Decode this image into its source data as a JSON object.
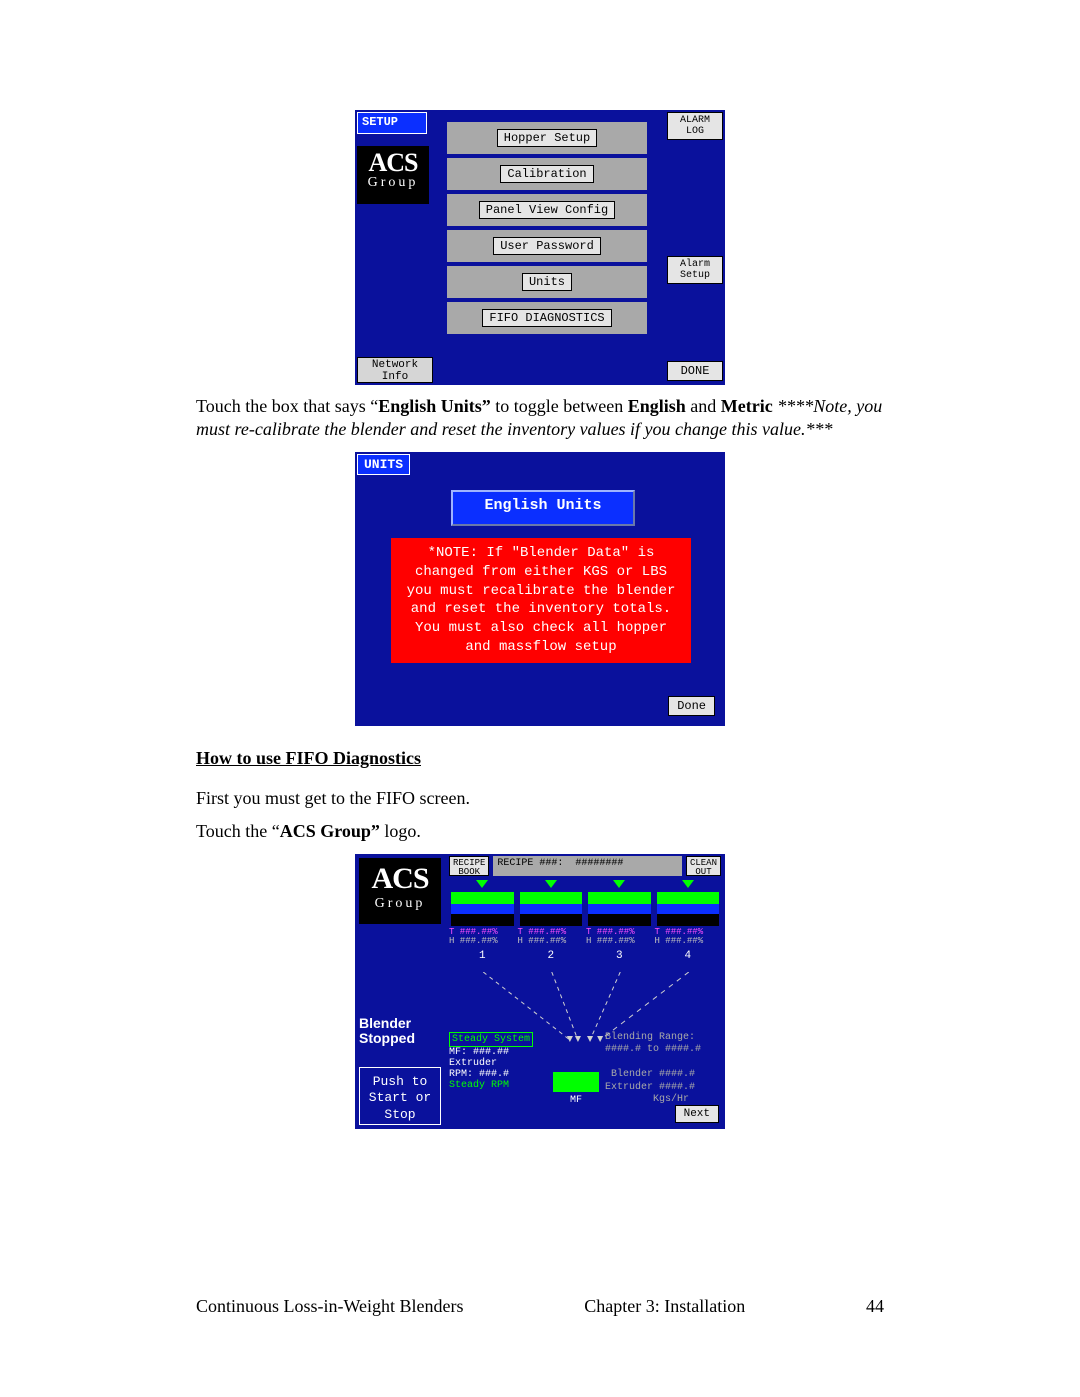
{
  "setup_screen": {
    "title": "SETUP",
    "logo_top": "ACS",
    "logo_bottom": "Group",
    "menu_items": [
      "Hopper Setup",
      "Calibration",
      "Panel View Config",
      "User Password",
      "Units",
      "FIFO DIAGNOSTICS"
    ],
    "network_btn": "Network\nInfo",
    "alarm_log_btn": "ALARM\nLOG",
    "alarm_setup_btn": "Alarm\nSetup",
    "done_btn": "DONE"
  },
  "paragraph1_prefix": "Touch the box that says “",
  "paragraph1_bold1": "English Units”",
  "paragraph1_mid": " to toggle between ",
  "paragraph1_bold2": "English",
  "paragraph1_and": " and ",
  "paragraph1_bold3": "Metric",
  "paragraph1_italic": " ****Note, you must re-calibrate the blender and reset the inventory values if you change this value.***",
  "units_screen": {
    "title": "UNITS",
    "toggle": "English Units",
    "note": "*NOTE:  If \"Blender Data\" is changed from either KGS or LBS you must recalibrate the blender and reset the inventory totals.  You must also check all hopper and massflow setup",
    "done": "Done"
  },
  "heading_fifo": "How to use FIFO Diagnostics",
  "paragraph_fifo1": "First you must get to the FIFO screen.",
  "paragraph_fifo2_prefix": "Touch the “",
  "paragraph_fifo2_bold": "ACS Group”",
  "paragraph_fifo2_suffix": " logo.",
  "main_screen": {
    "logo_top": "ACS",
    "logo_bottom": "Group",
    "recipe_book_btn": "RECIPE\nBOOK",
    "recipe_title": "RECIPE ###:  ########",
    "clean_out_btn": "CLEAN\nOUT",
    "hopper_line1": "T ###.##%",
    "hopper_line2": "H ###.##%",
    "hopper_numbers": [
      "1",
      "2",
      "3",
      "4"
    ],
    "blender_stopped": "Blender\nStopped",
    "push_btn": "Push to\nStart or\nStop",
    "steady_system": "Steady System",
    "mf": "MF: ###.##",
    "extruder": "Extruder",
    "rpm": "RPM:  ###.#",
    "steady_rpm": "Steady RPM",
    "mf_label": "MF",
    "right_text": "Blending Range:\n####.# to ####.#\n\n Blender ####.#\nExtruder ####.#\n        Kgs/Hr",
    "next": "Next"
  },
  "footer_left": "Continuous Loss-in-Weight Blenders",
  "footer_center": "Chapter 3: Installation",
  "footer_right": "44"
}
